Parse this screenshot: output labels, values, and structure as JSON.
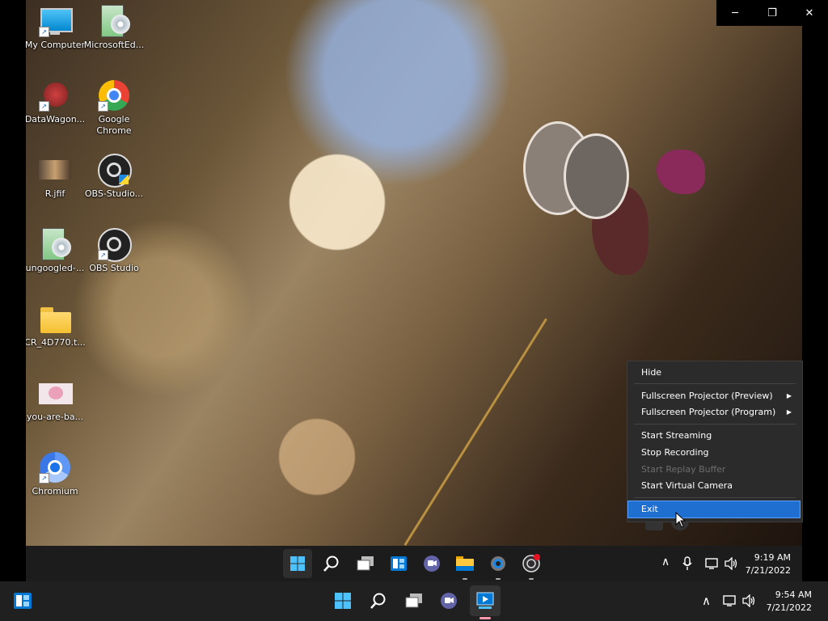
{
  "desktop_icons": [
    {
      "label": "My Computer",
      "icon": "monitor-icon"
    },
    {
      "label": "MicrosoftEd...",
      "icon": "installer-disc-icon"
    },
    {
      "label": "DataWagon...",
      "icon": "datawagon-icon"
    },
    {
      "label": "Google Chrome",
      "icon": "chrome-icon"
    },
    {
      "label": "R.jfif",
      "icon": "image-thumbnail-icon"
    },
    {
      "label": "OBS-Studio...",
      "icon": "obs-installer-icon"
    },
    {
      "label": "ungoogled-...",
      "icon": "installer-disc-icon"
    },
    {
      "label": "OBS Studio",
      "icon": "obs-icon"
    },
    {
      "label": "CR_4D770.t...",
      "icon": "folder-icon"
    },
    {
      "label": "you-are-ba...",
      "icon": "image-thumbnail-icon"
    },
    {
      "label": "Chromium",
      "icon": "chromium-icon"
    }
  ],
  "window_controls": {
    "minimize": "─",
    "restore": "❐",
    "close": "✕"
  },
  "context_menu": {
    "items": [
      {
        "label": "Hide",
        "state": "normal"
      },
      {
        "label": "Fullscreen Projector (Preview)",
        "state": "normal",
        "submenu": "▶"
      },
      {
        "label": "Fullscreen Projector (Program)",
        "state": "normal",
        "submenu": "▶"
      },
      {
        "label": "Start Streaming",
        "state": "normal"
      },
      {
        "label": "Stop Recording",
        "state": "normal"
      },
      {
        "label": "Start Replay Buffer",
        "state": "disabled"
      },
      {
        "label": "Start Virtual Camera",
        "state": "normal"
      },
      {
        "label": "Exit",
        "state": "highlighted"
      }
    ]
  },
  "inner_taskbar": {
    "time": "9:19 AM",
    "date": "7/21/2022",
    "tray_chevron": "∧",
    "icons": [
      "start-icon",
      "search-icon",
      "task-view-icon",
      "widgets-icon",
      "teams-chat-icon",
      "file-explorer-icon",
      "settings-icon",
      "obs-icon"
    ]
  },
  "outer_taskbar": {
    "time": "9:54 AM",
    "date": "7/21/2022",
    "tray_chevron": "∧",
    "icons": [
      "start-icon",
      "search-icon",
      "task-view-icon",
      "teams-chat-icon",
      "remote-desktop-icon"
    ]
  },
  "colors": {
    "menu_highlight": "#1f6fd1",
    "taskbar": "#202020",
    "accent_red": "#e81123"
  }
}
